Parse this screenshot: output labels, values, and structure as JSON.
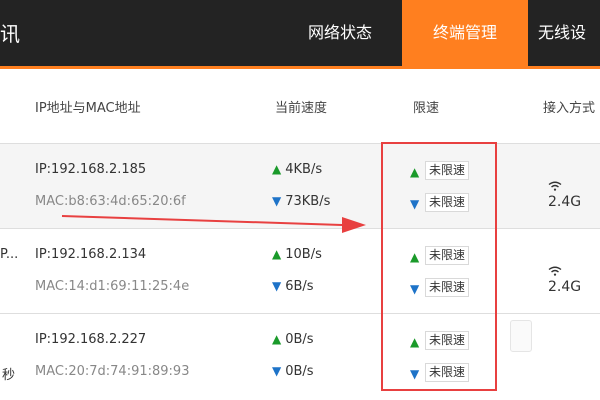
{
  "brand": {
    "tail": "讯"
  },
  "nav": {
    "tabs": [
      {
        "label": "网络状态",
        "active": false
      },
      {
        "label": "终端管理",
        "active": true
      },
      {
        "label": "无线设",
        "active": false
      }
    ]
  },
  "table": {
    "headers": [
      "IP地址与MAC地址",
      "当前速度",
      "限速",
      "接入方式"
    ],
    "rows": [
      {
        "name_trunc": "",
        "ip": "IP:192.168.2.185",
        "mac": "MAC:b8:63:4d:65:20:6f",
        "up_speed": "4KB/s",
        "down_speed": "73KB/s",
        "up_limit": "未限速",
        "down_limit": "未限速",
        "access": "2.4G"
      },
      {
        "name_trunc": "P...",
        "ip": "IP:192.168.2.134",
        "mac": "MAC:14:d1:69:11:25:4e",
        "up_speed": "10B/s",
        "down_speed": "6B/s",
        "up_limit": "未限速",
        "down_limit": "未限速",
        "access": "2.4G"
      },
      {
        "name_trunc": "秒",
        "ip": "IP:192.168.2.227",
        "mac": "MAC:20:7d:74:91:89:93",
        "up_speed": "0B/s",
        "down_speed": "0B/s",
        "up_limit": "未限速",
        "down_limit": "未限速",
        "access": ""
      }
    ]
  },
  "colors": {
    "accent": "#ff7f1f",
    "topbar": "#232323",
    "highlight": "#e84040",
    "up": "#1a9a2a",
    "down": "#1e73c8"
  }
}
